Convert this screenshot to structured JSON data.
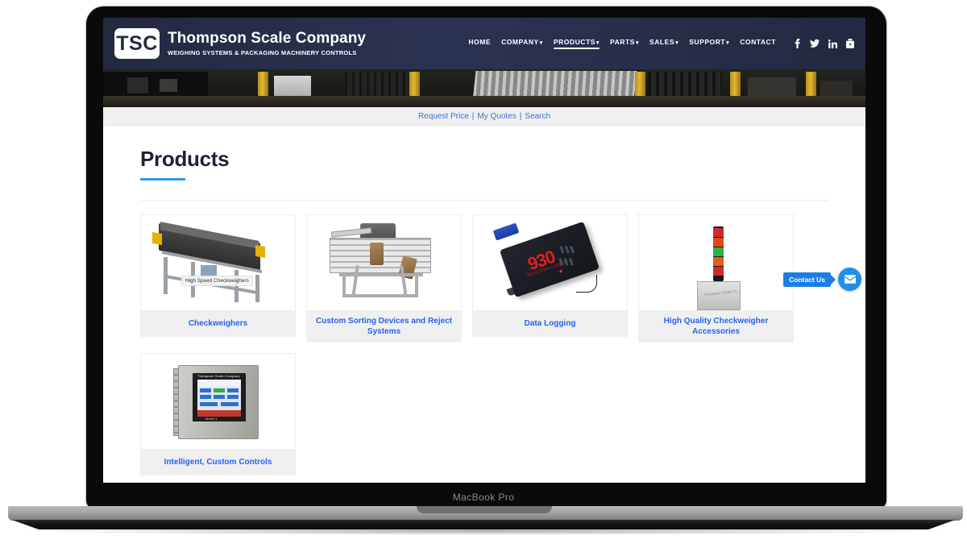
{
  "device": {
    "label": "MacBook Pro"
  },
  "header": {
    "logo_badge": "TSC",
    "logo_title": "Thompson Scale Company",
    "logo_subtitle": "WEIGHING SYSTEMS & PACKAGING MACHINERY CONTROLS",
    "nav": [
      {
        "label": "HOME",
        "caret": "",
        "active": false
      },
      {
        "label": "COMPANY",
        "caret": "▾",
        "active": false
      },
      {
        "label": "PRODUCTS",
        "caret": "▾",
        "active": true
      },
      {
        "label": "PARTS",
        "caret": "▾",
        "active": false
      },
      {
        "label": "SALES",
        "caret": "▾",
        "active": false
      },
      {
        "label": "SUPPORT",
        "caret": "▾",
        "active": false
      },
      {
        "label": "CONTACT",
        "caret": "",
        "active": false
      }
    ],
    "social": [
      "facebook-icon",
      "twitter-icon",
      "linkedin-icon",
      "youtube-icon"
    ],
    "brand_navy": "#252c47"
  },
  "utility_bar": {
    "request_price": "Request Price",
    "my_quotes": "My Quotes",
    "search": "Search",
    "separator": "|",
    "link_color": "#3a6fd8"
  },
  "main": {
    "page_title": "Products",
    "accent_color": "#2f9ae8",
    "caption_color": "#2563eb",
    "products": [
      {
        "title": "Checkweighers",
        "image_name": "conveyor-checkweigher-photo",
        "image_overlay": "High Speed Checkweighers"
      },
      {
        "title": "Custom Sorting Devices and Reject Systems",
        "image_name": "roller-sorting-conveyor-photo",
        "image_overlay": ""
      },
      {
        "title": "Data Logging",
        "image_name": "serial-data-logger-photo",
        "image_overlay": "930",
        "image_overlay_sub": "Serial Data Logger"
      },
      {
        "title": "High Quality Checkweigher Accessories",
        "image_name": "stack-light-tower-photo",
        "image_overlay": "Thompson Scale Co."
      },
      {
        "title": "Intelligent, Custom Controls",
        "image_name": "control-panel-enclosure-photo",
        "image_overlay": "Thompson Scale Company"
      }
    ]
  },
  "contact_widget": {
    "tooltip": "Contact Us",
    "icon": "envelope-icon",
    "color": "#1f8fe8"
  }
}
